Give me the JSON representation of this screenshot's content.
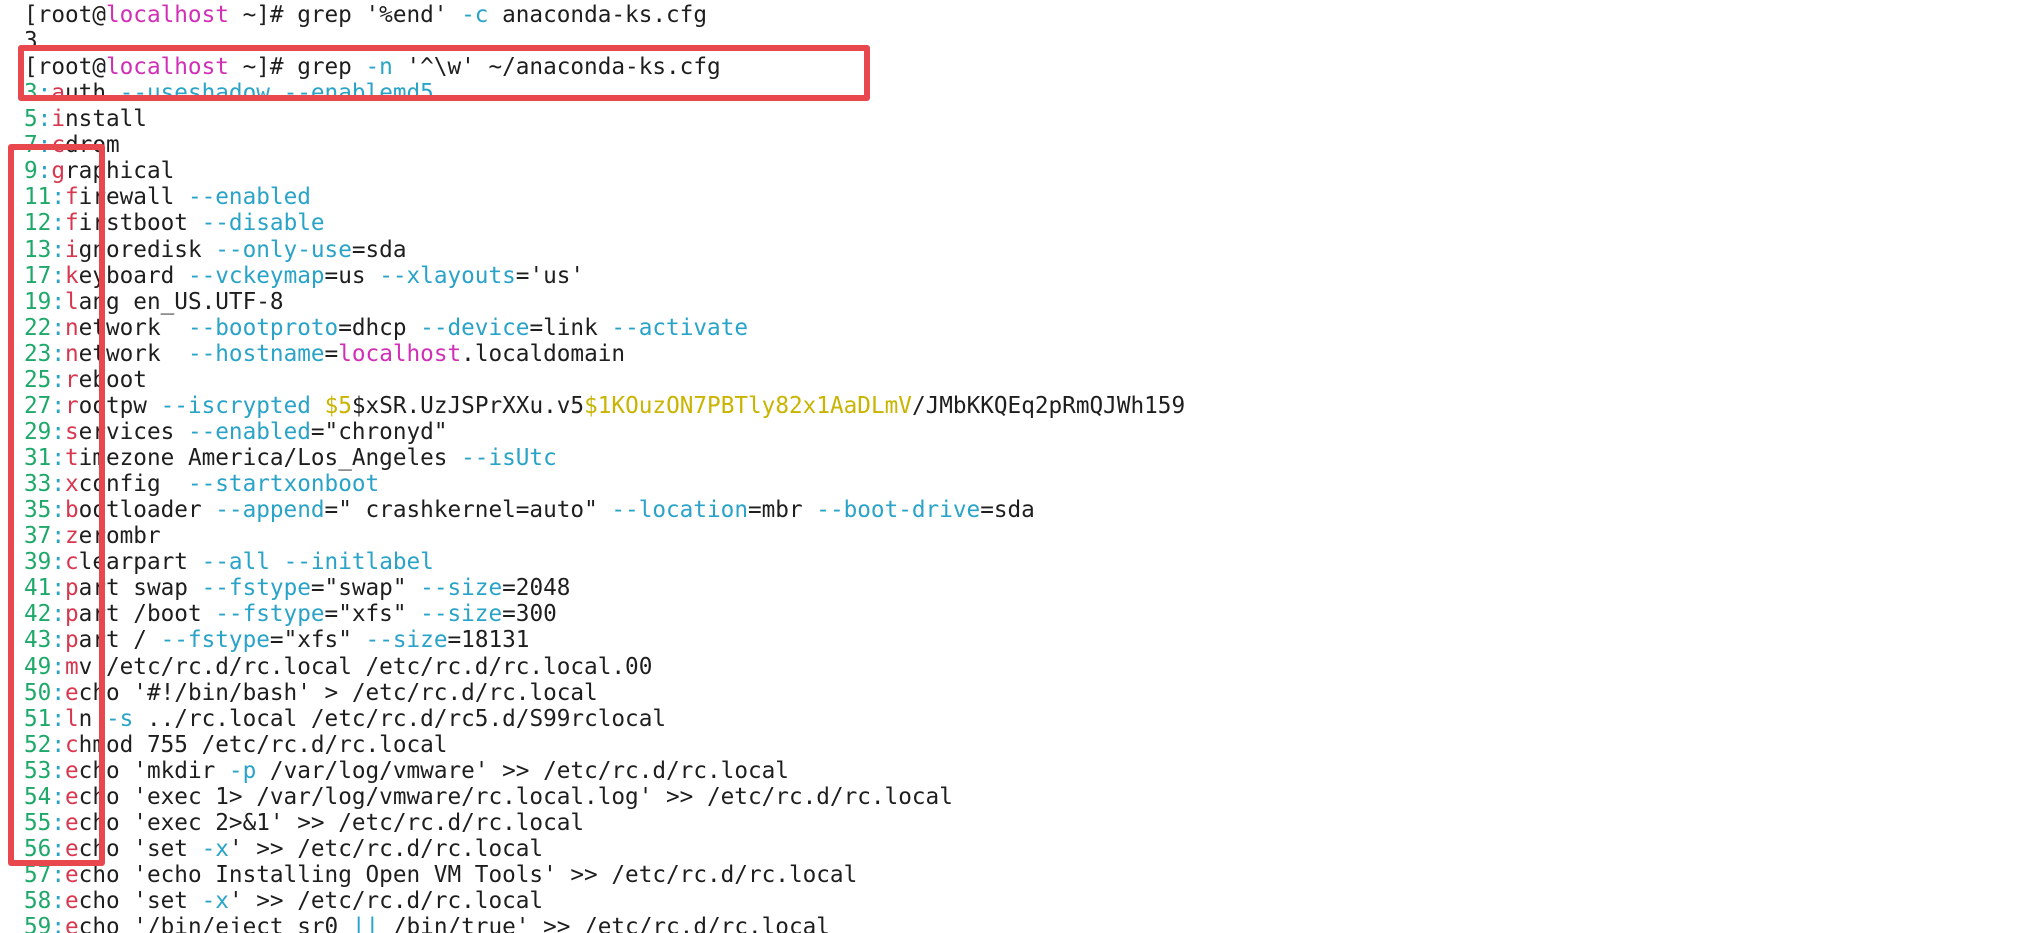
{
  "terminal": {
    "lines": [
      [
        {
          "t": "[root@",
          "c": "default"
        },
        {
          "t": "localhost",
          "c": "host"
        },
        {
          "t": " ~]# grep '%end' ",
          "c": "default"
        },
        {
          "t": "-c",
          "c": "opt"
        },
        {
          "t": " anaconda-ks.cfg",
          "c": "default"
        }
      ],
      [
        {
          "t": "3",
          "c": "default"
        }
      ],
      [
        {
          "t": "[root@",
          "c": "default"
        },
        {
          "t": "localhost",
          "c": "host"
        },
        {
          "t": " ~]# grep ",
          "c": "default"
        },
        {
          "t": "-n",
          "c": "opt"
        },
        {
          "t": " '^\\w' ~/anaconda-ks.cfg",
          "c": "default"
        }
      ],
      [
        {
          "t": "3",
          "c": "lineno"
        },
        {
          "t": ":",
          "c": "colon"
        },
        {
          "t": "a",
          "c": "first"
        },
        {
          "t": "uth ",
          "c": "default"
        },
        {
          "t": "--useshadow",
          "c": "opt"
        },
        {
          "t": " ",
          "c": "default"
        },
        {
          "t": "--enablemd5",
          "c": "opt"
        }
      ],
      [
        {
          "t": "5",
          "c": "lineno"
        },
        {
          "t": ":",
          "c": "colon"
        },
        {
          "t": "i",
          "c": "first"
        },
        {
          "t": "nstall",
          "c": "default"
        }
      ],
      [
        {
          "t": "7",
          "c": "lineno"
        },
        {
          "t": ":",
          "c": "colon"
        },
        {
          "t": "c",
          "c": "first"
        },
        {
          "t": "drom",
          "c": "default"
        }
      ],
      [
        {
          "t": "9",
          "c": "lineno"
        },
        {
          "t": ":",
          "c": "colon"
        },
        {
          "t": "g",
          "c": "first"
        },
        {
          "t": "raphical",
          "c": "default"
        }
      ],
      [
        {
          "t": "11",
          "c": "lineno"
        },
        {
          "t": ":",
          "c": "colon"
        },
        {
          "t": "f",
          "c": "first"
        },
        {
          "t": "irewall ",
          "c": "default"
        },
        {
          "t": "--enabled",
          "c": "opt"
        }
      ],
      [
        {
          "t": "12",
          "c": "lineno"
        },
        {
          "t": ":",
          "c": "colon"
        },
        {
          "t": "f",
          "c": "first"
        },
        {
          "t": "irstboot ",
          "c": "default"
        },
        {
          "t": "--disable",
          "c": "opt"
        }
      ],
      [
        {
          "t": "13",
          "c": "lineno"
        },
        {
          "t": ":",
          "c": "colon"
        },
        {
          "t": "i",
          "c": "first"
        },
        {
          "t": "gnoredisk ",
          "c": "default"
        },
        {
          "t": "--only-use",
          "c": "opt"
        },
        {
          "t": "=sda",
          "c": "default"
        }
      ],
      [
        {
          "t": "17",
          "c": "lineno"
        },
        {
          "t": ":",
          "c": "colon"
        },
        {
          "t": "k",
          "c": "first"
        },
        {
          "t": "eyboard ",
          "c": "default"
        },
        {
          "t": "--vckeymap",
          "c": "opt"
        },
        {
          "t": "=us ",
          "c": "default"
        },
        {
          "t": "--xlayouts",
          "c": "opt"
        },
        {
          "t": "='us'",
          "c": "default"
        }
      ],
      [
        {
          "t": "19",
          "c": "lineno"
        },
        {
          "t": ":",
          "c": "colon"
        },
        {
          "t": "l",
          "c": "first"
        },
        {
          "t": "ang en_US.UTF-8",
          "c": "default"
        }
      ],
      [
        {
          "t": "22",
          "c": "lineno"
        },
        {
          "t": ":",
          "c": "colon"
        },
        {
          "t": "n",
          "c": "first"
        },
        {
          "t": "etwork  ",
          "c": "default"
        },
        {
          "t": "--bootproto",
          "c": "opt"
        },
        {
          "t": "=dhcp ",
          "c": "default"
        },
        {
          "t": "--device",
          "c": "opt"
        },
        {
          "t": "=link ",
          "c": "default"
        },
        {
          "t": "--activate",
          "c": "opt"
        }
      ],
      [
        {
          "t": "23",
          "c": "lineno"
        },
        {
          "t": ":",
          "c": "colon"
        },
        {
          "t": "n",
          "c": "first"
        },
        {
          "t": "etwork  ",
          "c": "default"
        },
        {
          "t": "--hostname",
          "c": "opt"
        },
        {
          "t": "=",
          "c": "default"
        },
        {
          "t": "localhost",
          "c": "host"
        },
        {
          "t": ".localdomain",
          "c": "default"
        }
      ],
      [
        {
          "t": "25",
          "c": "lineno"
        },
        {
          "t": ":",
          "c": "colon"
        },
        {
          "t": "r",
          "c": "first"
        },
        {
          "t": "eboot",
          "c": "default"
        }
      ],
      [
        {
          "t": "27",
          "c": "lineno"
        },
        {
          "t": ":",
          "c": "colon"
        },
        {
          "t": "r",
          "c": "first"
        },
        {
          "t": "ootpw ",
          "c": "default"
        },
        {
          "t": "--iscrypted",
          "c": "opt"
        },
        {
          "t": " ",
          "c": "default"
        },
        {
          "t": "$5",
          "c": "dollar"
        },
        {
          "t": "$xSR.UzJSPrXXu.v5",
          "c": "default"
        },
        {
          "t": "$1KOuzON7PBTly82x1AaDLmV",
          "c": "yellow"
        },
        {
          "t": "/JMbKKQEq2pRmQJWh159",
          "c": "default"
        }
      ],
      [
        {
          "t": "29",
          "c": "lineno"
        },
        {
          "t": ":",
          "c": "colon"
        },
        {
          "t": "s",
          "c": "first"
        },
        {
          "t": "ervices ",
          "c": "default"
        },
        {
          "t": "--enabled",
          "c": "opt"
        },
        {
          "t": "=\"chronyd\"",
          "c": "default"
        }
      ],
      [
        {
          "t": "31",
          "c": "lineno"
        },
        {
          "t": ":",
          "c": "colon"
        },
        {
          "t": "t",
          "c": "first"
        },
        {
          "t": "imezone America/Los_Angeles ",
          "c": "default"
        },
        {
          "t": "--isUtc",
          "c": "opt"
        }
      ],
      [
        {
          "t": "33",
          "c": "lineno"
        },
        {
          "t": ":",
          "c": "colon"
        },
        {
          "t": "x",
          "c": "first"
        },
        {
          "t": "config  ",
          "c": "default"
        },
        {
          "t": "--startxonboot",
          "c": "opt"
        }
      ],
      [
        {
          "t": "35",
          "c": "lineno"
        },
        {
          "t": ":",
          "c": "colon"
        },
        {
          "t": "b",
          "c": "first"
        },
        {
          "t": "ootloader ",
          "c": "default"
        },
        {
          "t": "--append",
          "c": "opt"
        },
        {
          "t": "=\" crashkernel=auto\" ",
          "c": "default"
        },
        {
          "t": "--location",
          "c": "opt"
        },
        {
          "t": "=mbr ",
          "c": "default"
        },
        {
          "t": "--boot-drive",
          "c": "opt"
        },
        {
          "t": "=sda",
          "c": "default"
        }
      ],
      [
        {
          "t": "37",
          "c": "lineno"
        },
        {
          "t": ":",
          "c": "colon"
        },
        {
          "t": "z",
          "c": "first"
        },
        {
          "t": "erombr",
          "c": "default"
        }
      ],
      [
        {
          "t": "39",
          "c": "lineno"
        },
        {
          "t": ":",
          "c": "colon"
        },
        {
          "t": "c",
          "c": "first"
        },
        {
          "t": "learpart ",
          "c": "default"
        },
        {
          "t": "--all",
          "c": "opt"
        },
        {
          "t": " ",
          "c": "default"
        },
        {
          "t": "--initlabel",
          "c": "opt"
        }
      ],
      [
        {
          "t": "41",
          "c": "lineno"
        },
        {
          "t": ":",
          "c": "colon"
        },
        {
          "t": "p",
          "c": "first"
        },
        {
          "t": "art swap ",
          "c": "default"
        },
        {
          "t": "--fstype",
          "c": "opt"
        },
        {
          "t": "=\"swap\" ",
          "c": "default"
        },
        {
          "t": "--size",
          "c": "opt"
        },
        {
          "t": "=2048",
          "c": "default"
        }
      ],
      [
        {
          "t": "42",
          "c": "lineno"
        },
        {
          "t": ":",
          "c": "colon"
        },
        {
          "t": "p",
          "c": "first"
        },
        {
          "t": "art /boot ",
          "c": "default"
        },
        {
          "t": "--fstype",
          "c": "opt"
        },
        {
          "t": "=\"xfs\" ",
          "c": "default"
        },
        {
          "t": "--size",
          "c": "opt"
        },
        {
          "t": "=300",
          "c": "default"
        }
      ],
      [
        {
          "t": "43",
          "c": "lineno"
        },
        {
          "t": ":",
          "c": "colon"
        },
        {
          "t": "p",
          "c": "first"
        },
        {
          "t": "art / ",
          "c": "default"
        },
        {
          "t": "--fstype",
          "c": "opt"
        },
        {
          "t": "=\"xfs\" ",
          "c": "default"
        },
        {
          "t": "--size",
          "c": "opt"
        },
        {
          "t": "=18131",
          "c": "default"
        }
      ],
      [
        {
          "t": "49",
          "c": "lineno"
        },
        {
          "t": ":",
          "c": "colon"
        },
        {
          "t": "m",
          "c": "first"
        },
        {
          "t": "v /etc/rc.d/rc.local /etc/rc.d/rc.local.00",
          "c": "default"
        }
      ],
      [
        {
          "t": "50",
          "c": "lineno"
        },
        {
          "t": ":",
          "c": "colon"
        },
        {
          "t": "e",
          "c": "first"
        },
        {
          "t": "cho '#!/bin/bash' > /etc/rc.d/rc.local",
          "c": "default"
        }
      ],
      [
        {
          "t": "51",
          "c": "lineno"
        },
        {
          "t": ":",
          "c": "colon"
        },
        {
          "t": "l",
          "c": "first"
        },
        {
          "t": "n ",
          "c": "default"
        },
        {
          "t": "-s",
          "c": "opt"
        },
        {
          "t": " ../rc.local /etc/rc.d/rc5.d/S99rclocal",
          "c": "default"
        }
      ],
      [
        {
          "t": "52",
          "c": "lineno"
        },
        {
          "t": ":",
          "c": "colon"
        },
        {
          "t": "c",
          "c": "first"
        },
        {
          "t": "hmod 755 /etc/rc.d/rc.local",
          "c": "default"
        }
      ],
      [
        {
          "t": "53",
          "c": "lineno"
        },
        {
          "t": ":",
          "c": "colon"
        },
        {
          "t": "e",
          "c": "first"
        },
        {
          "t": "cho 'mkdir ",
          "c": "default"
        },
        {
          "t": "-p",
          "c": "opt"
        },
        {
          "t": " /var/log/vmware' >> /etc/rc.d/rc.local",
          "c": "default"
        }
      ],
      [
        {
          "t": "54",
          "c": "lineno"
        },
        {
          "t": ":",
          "c": "colon"
        },
        {
          "t": "e",
          "c": "first"
        },
        {
          "t": "cho 'exec 1> /var/log/vmware/rc.local.log' >> /etc/rc.d/rc.local",
          "c": "default"
        }
      ],
      [
        {
          "t": "55",
          "c": "lineno"
        },
        {
          "t": ":",
          "c": "colon"
        },
        {
          "t": "e",
          "c": "first"
        },
        {
          "t": "cho 'exec 2>&1' >> /etc/rc.d/rc.local",
          "c": "default"
        }
      ],
      [
        {
          "t": "56",
          "c": "lineno"
        },
        {
          "t": ":",
          "c": "colon"
        },
        {
          "t": "e",
          "c": "first"
        },
        {
          "t": "cho 'set ",
          "c": "default"
        },
        {
          "t": "-x",
          "c": "opt"
        },
        {
          "t": "' >> /etc/rc.d/rc.local",
          "c": "default"
        }
      ],
      [
        {
          "t": "57",
          "c": "lineno"
        },
        {
          "t": ":",
          "c": "colon"
        },
        {
          "t": "e",
          "c": "first"
        },
        {
          "t": "cho 'echo Installing Open VM Tools' >> /etc/rc.d/rc.local",
          "c": "default"
        }
      ],
      [
        {
          "t": "58",
          "c": "lineno"
        },
        {
          "t": ":",
          "c": "colon"
        },
        {
          "t": "e",
          "c": "first"
        },
        {
          "t": "cho 'set ",
          "c": "default"
        },
        {
          "t": "-x",
          "c": "opt"
        },
        {
          "t": "' >> /etc/rc.d/rc.local",
          "c": "default"
        }
      ],
      [
        {
          "t": "59",
          "c": "lineno"
        },
        {
          "t": ":",
          "c": "colon"
        },
        {
          "t": "e",
          "c": "first"
        },
        {
          "t": "cho '/bin/eject sr0 ",
          "c": "default"
        },
        {
          "t": "||",
          "c": "opt"
        },
        {
          "t": " /bin/true' >> /etc/rc.d/rc.local",
          "c": "default"
        }
      ]
    ]
  },
  "colors": {
    "background": "#ffffff",
    "text": "#1e1e1e",
    "line_number": "#1ea96a",
    "option": "#2aa3c8",
    "first_char": "#d7374f",
    "hostname": "#d02fb6",
    "dollar": "#c9b400",
    "highlight_box": "#e8474e"
  }
}
